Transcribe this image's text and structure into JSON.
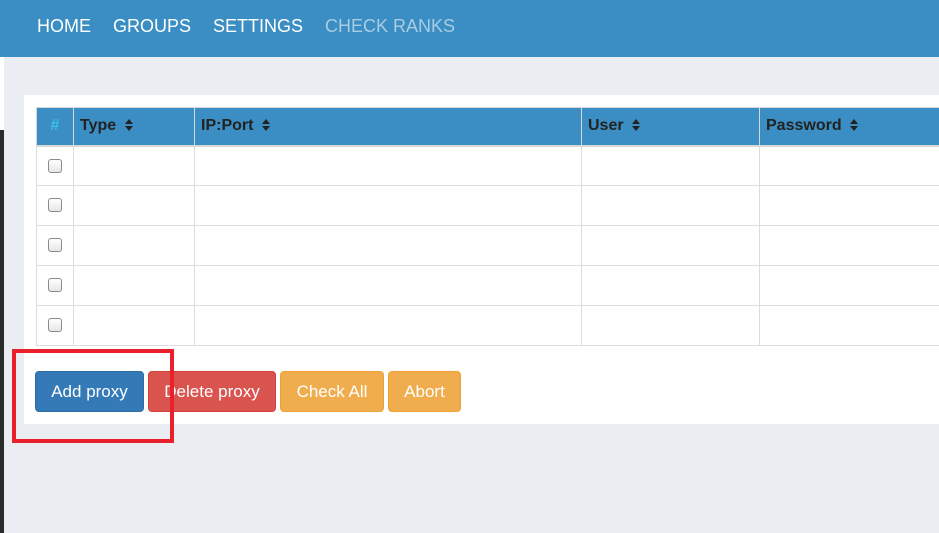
{
  "nav": {
    "items": [
      {
        "label": "HOME"
      },
      {
        "label": "GROUPS"
      },
      {
        "label": "SETTINGS"
      },
      {
        "label": "CHECK RANKS"
      }
    ]
  },
  "table": {
    "columns": [
      {
        "label": "#"
      },
      {
        "label": "Type"
      },
      {
        "label": "IP:Port"
      },
      {
        "label": "User"
      },
      {
        "label": "Password"
      }
    ],
    "rows": [
      {
        "checked": false,
        "type": "",
        "ip_port": "",
        "user": "",
        "password": ""
      },
      {
        "checked": false,
        "type": "",
        "ip_port": "",
        "user": "",
        "password": ""
      },
      {
        "checked": false,
        "type": "",
        "ip_port": "",
        "user": "",
        "password": ""
      },
      {
        "checked": false,
        "type": "",
        "ip_port": "",
        "user": "",
        "password": ""
      },
      {
        "checked": false,
        "type": "",
        "ip_port": "",
        "user": "",
        "password": ""
      }
    ]
  },
  "actions": {
    "add_proxy": "Add proxy",
    "delete_proxy": "Delete proxy",
    "check_all": "Check All",
    "abort": "Abort"
  },
  "colors": {
    "navbar": "#3b8ec3",
    "primary": "#337ab7",
    "danger": "#d9534f",
    "warning": "#f0ad4e",
    "highlight": "#e8212b"
  }
}
